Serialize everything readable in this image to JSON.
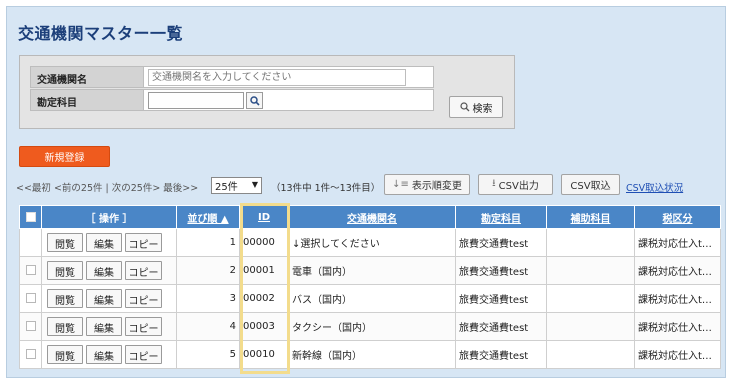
{
  "page": {
    "title": "交通機関マスター一覧"
  },
  "search": {
    "name_label": "交通機関名",
    "name_placeholder": "交通機関名を入力してください",
    "name_value": "",
    "account_label": "勘定科目",
    "account_value": "",
    "search_button": "検索"
  },
  "toolbar": {
    "new_button": "新規登録",
    "pager_text": "<<最初 <前の25件 | 次の25件> 最後>>",
    "per_page": "25件",
    "range_text": "（13件中 1件〜13件目）",
    "reorder_button": "表示順変更",
    "csv_export_button": "CSV出力",
    "csv_import_button": "CSV取込",
    "csv_status_link": "CSV取込状況"
  },
  "table": {
    "headers": {
      "ops": "［ 操作 ］",
      "order": "並び順 ▲",
      "id": "ID",
      "name": "交通機関名",
      "account": "勘定科目",
      "sub_account": "補助科目",
      "tax": "税区分"
    },
    "action_labels": {
      "view": "閲覧",
      "edit": "編集",
      "copy": "コピー"
    },
    "rows": [
      {
        "order": "1",
        "id": "00000",
        "name": "↓選択してください",
        "account": "旅費交通費test",
        "sub_account": "",
        "tax": "課税対応仕入t…"
      },
      {
        "order": "2",
        "id": "00001",
        "name": "電車（国内）",
        "account": "旅費交通費test",
        "sub_account": "",
        "tax": "課税対応仕入t…"
      },
      {
        "order": "3",
        "id": "00002",
        "name": "バス（国内）",
        "account": "旅費交通費test",
        "sub_account": "",
        "tax": "課税対応仕入t…"
      },
      {
        "order": "4",
        "id": "00003",
        "name": "タクシー（国内）",
        "account": "旅費交通費test",
        "sub_account": "",
        "tax": "課税対応仕入t…"
      },
      {
        "order": "5",
        "id": "00010",
        "name": "新幹線（国内）",
        "account": "旅費交通費test",
        "sub_account": "",
        "tax": "課税対応仕入t…"
      }
    ]
  },
  "colors": {
    "header_blue": "#4a86c7",
    "panel_bg": "#d7e6f4",
    "new_button_orange": "#ef5b1e",
    "title_navy": "#1c3f7a",
    "highlight_yellow": "#f3dc8c"
  }
}
